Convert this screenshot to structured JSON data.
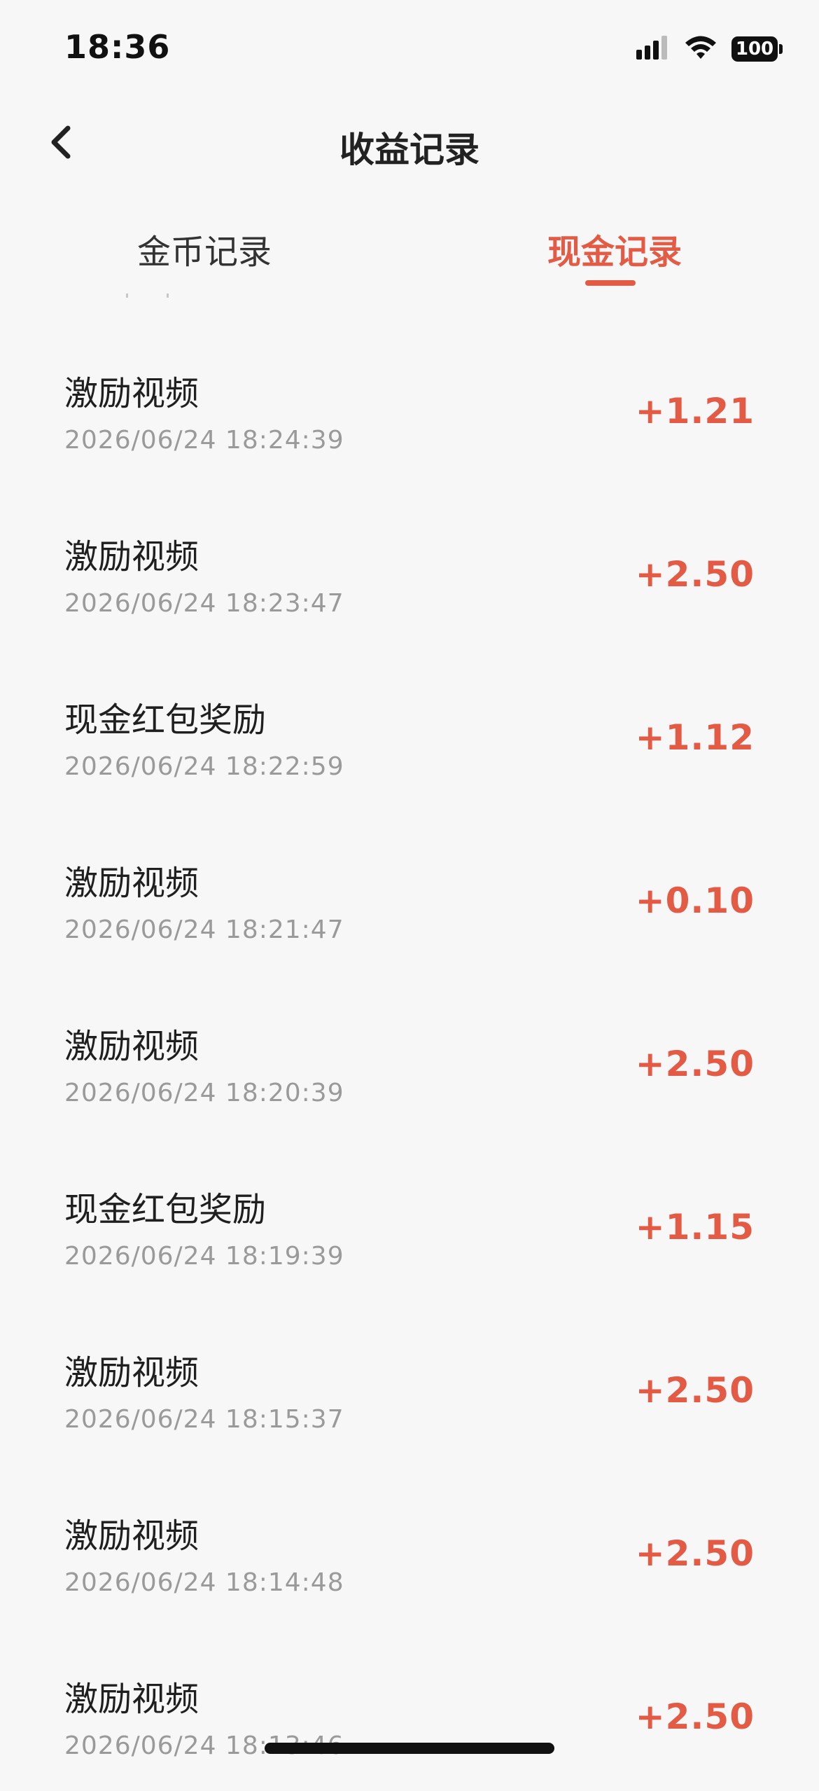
{
  "status_bar": {
    "time": "18:36",
    "battery": "100",
    "icons": [
      "signal-icon",
      "wifi-icon",
      "battery-icon"
    ]
  },
  "nav": {
    "title": "收益记录",
    "back_icon": "chevron-left-icon"
  },
  "tabs": [
    {
      "label": "金币记录",
      "active": false
    },
    {
      "label": "现金记录",
      "active": true
    }
  ],
  "colors": {
    "accent": "#e35a45",
    "background": "#f7f7f7",
    "secondary_text": "#9a9a9a"
  },
  "records": [
    {
      "title": "激励视频",
      "time": "2026/06/24 18:24:39",
      "amount": "+1.21"
    },
    {
      "title": "激励视频",
      "time": "2026/06/24 18:23:47",
      "amount": "+2.50"
    },
    {
      "title": "现金红包奖励",
      "time": "2026/06/24 18:22:59",
      "amount": "+1.12"
    },
    {
      "title": "激励视频",
      "time": "2026/06/24 18:21:47",
      "amount": "+0.10"
    },
    {
      "title": "激励视频",
      "time": "2026/06/24 18:20:39",
      "amount": "+2.50"
    },
    {
      "title": "现金红包奖励",
      "time": "2026/06/24 18:19:39",
      "amount": "+1.15"
    },
    {
      "title": "激励视频",
      "time": "2026/06/24 18:15:37",
      "amount": "+2.50"
    },
    {
      "title": "激励视频",
      "time": "2026/06/24 18:14:48",
      "amount": "+2.50"
    },
    {
      "title": "激励视频",
      "time": "2026/06/24 18:13:46",
      "amount": "+2.50"
    }
  ]
}
